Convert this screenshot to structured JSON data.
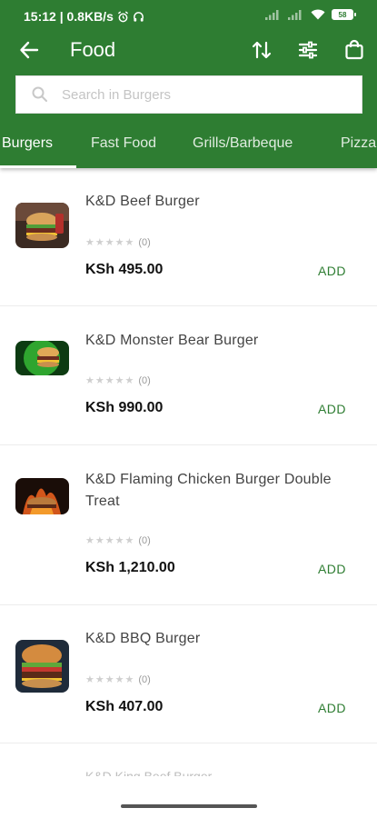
{
  "status_bar": {
    "time_speed": "15:12 | 0.8KB/s",
    "battery": "58"
  },
  "appbar": {
    "title": "Food",
    "back_icon": "arrow-left-icon",
    "sort_icon": "sort-arrows-icon",
    "filter_icon": "sliders-icon",
    "cart_icon": "shopping-bag-icon"
  },
  "search": {
    "placeholder": "Search in Burgers",
    "value": ""
  },
  "tabs": [
    {
      "label": "Burgers",
      "active": true
    },
    {
      "label": "Fast Food",
      "active": false
    },
    {
      "label": "Grills/Barbeque",
      "active": false
    },
    {
      "label": "Pizza",
      "active": false
    }
  ],
  "products": [
    {
      "name": "K&D Beef Burger",
      "rating_count": "(0)",
      "price": "KSh 495.00",
      "add_label": "ADD",
      "stars": 0
    },
    {
      "name": "K&D Monster Bear Burger",
      "rating_count": "(0)",
      "price": "KSh 990.00",
      "add_label": "ADD",
      "stars": 0
    },
    {
      "name": "K&D Flaming Chicken Burger Double Treat",
      "rating_count": "(0)",
      "price": "KSh 1,210.00",
      "add_label": "ADD",
      "stars": 0
    },
    {
      "name": "K&D BBQ Burger",
      "rating_count": "(0)",
      "price": "KSh 407.00",
      "add_label": "ADD",
      "stars": 0
    }
  ],
  "partial_item": {
    "name": "K&D King Beef Burger"
  },
  "stars_glyph": "★★★★★",
  "colors": {
    "primary": "#2e7d32",
    "accent_text": "#2e7d32"
  }
}
